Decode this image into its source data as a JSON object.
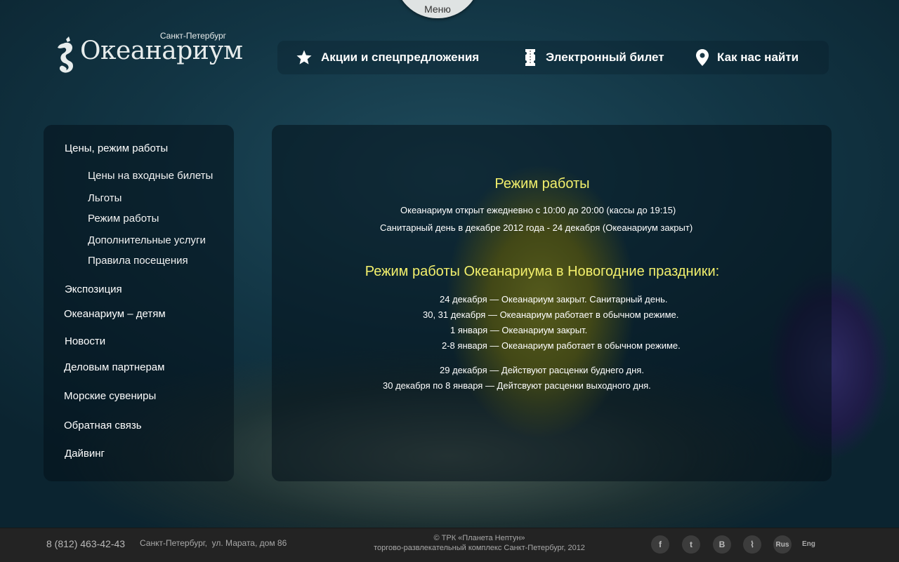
{
  "menu_tab": {
    "label": "Меню"
  },
  "logo": {
    "city": "Санкт-Петербург",
    "name": "Океанариум"
  },
  "topnav": {
    "items": [
      {
        "label": "Акции и спецпредложения",
        "icon": "star-icon"
      },
      {
        "label": "Электронный билет",
        "icon": "ticket-icon"
      },
      {
        "label": "Как нас найти",
        "icon": "map-pin-icon"
      }
    ]
  },
  "sidebar": {
    "items": [
      {
        "label": "Цены, режим работы"
      },
      {
        "label": "Цены на входные билеты"
      },
      {
        "label": "Льготы"
      },
      {
        "label": "Режим работы"
      },
      {
        "label": "Дополнительные услуги"
      },
      {
        "label": "Правила посещения"
      },
      {
        "label": "Экспозиция"
      },
      {
        "label": "Океанариум – детям"
      },
      {
        "label": "Новости"
      },
      {
        "label": "Деловым партнерам"
      },
      {
        "label": "Морские сувениры"
      },
      {
        "label": "Обратная связь"
      },
      {
        "label": "Дайвинг"
      }
    ]
  },
  "content": {
    "title": "Режим работы",
    "lines": [
      "Океанариум открыт ежедневно с 10:00 до 20:00 (кассы до 19:15)",
      "Санитарный день в декабре 2012 года - 24 декабря (Океанариум закрыт)"
    ],
    "holiday_title": "Режим работы Океанариума в Новогодние праздники:",
    "holiday_lines": [
      "24 декабря — Океанариум закрыт. Санитарный день.",
      "30, 31 декабря — Океанариум работает в обычном режиме.",
      "1 января — Океанариум закрыт.",
      "2-8 января — Океанариум работает в обычном режиме.",
      "29 декабря — Действуют расценки буднего дня.",
      "30 декабря по 8 января — Дейтсвуют расценки выходного дня."
    ]
  },
  "footer": {
    "phone": "8 (812) 463-42-43",
    "address": "Санкт-Петербург,  ул. Марата, дом 86",
    "copyright_1": "© ТРК «Планета Нептун»",
    "copyright_2": "торгово-развлекательный комплекс Санкт-Петербург, 2012",
    "social": [
      {
        "icon": "facebook-icon",
        "glyph": "f"
      },
      {
        "icon": "twitter-icon",
        "glyph": "t"
      },
      {
        "icon": "vkontakte-icon",
        "glyph": "В"
      },
      {
        "icon": "paperclip-icon",
        "glyph": "⌇"
      }
    ],
    "lang_rus": "Rus",
    "lang_eng": "Eng"
  }
}
